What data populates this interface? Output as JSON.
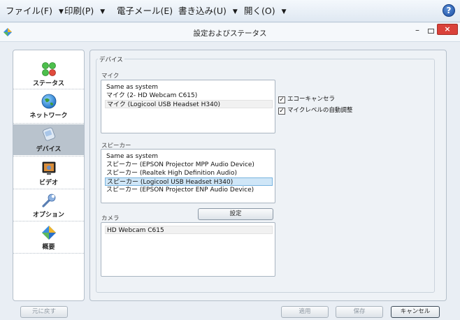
{
  "menubar": {
    "items": [
      {
        "label": "ファイル(F)"
      },
      {
        "label": "印刷(P)"
      },
      {
        "label": "電子メール(E)"
      },
      {
        "label": "書き込み(U)"
      },
      {
        "label": "開く(O)"
      }
    ],
    "help_icon": "help-icon",
    "help_glyph": "?"
  },
  "window": {
    "title": "設定およびステータス",
    "minimize_glyph": "–",
    "close_glyph": "×"
  },
  "nav": {
    "items": [
      {
        "label": "ステータス",
        "icon": "status-lights-icon"
      },
      {
        "label": "ネットワーク",
        "icon": "globe-icon"
      },
      {
        "label": "デバイス",
        "icon": "device-icon",
        "selected": true
      },
      {
        "label": "ビデオ",
        "icon": "monitor-icon"
      },
      {
        "label": "オプション",
        "icon": "wrench-icon"
      },
      {
        "label": "概要",
        "icon": "about-icon"
      }
    ]
  },
  "devices": {
    "group_title": "デバイス",
    "mic": {
      "label": "マイク",
      "options": [
        "Same as system",
        "マイク (2- HD Webcam C615)",
        "マイク (Logicool USB Headset H340)"
      ],
      "selected_index": 2
    },
    "echo_cancel": {
      "label": "エコーキャンセラ",
      "checked": true
    },
    "auto_gain": {
      "label": "マイクレベルの自動調整",
      "checked": true
    },
    "speaker": {
      "label": "スピーカー",
      "options": [
        "Same as system",
        "スピーカー (EPSON Projector MPP Audio Device)",
        "スピーカー (Realtek High Definition Audio)",
        "スピーカー (Logicool USB Headset H340)",
        "スピーカー (EPSON Projector ENP Audio Device)"
      ],
      "selected_index": 3
    },
    "camera": {
      "label": "カメラ",
      "options": [
        "HD Webcam C615"
      ],
      "selected_index": 0,
      "settings_button": "設定"
    },
    "check_glyph": "✓"
  },
  "footer": {
    "reset_button": "元に戻す",
    "apply_button": "適用",
    "save_button": "保存",
    "cancel_button": "キャンセル"
  },
  "colors": {
    "selected_nav": "#b9c3cd",
    "selected_row": "#cfe6f7",
    "close_button": "#d9413a"
  }
}
